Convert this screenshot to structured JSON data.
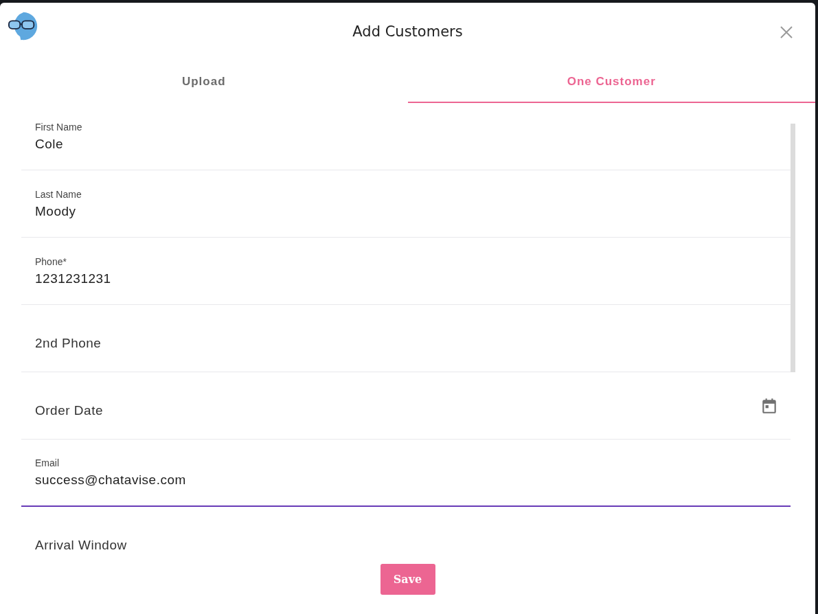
{
  "dialog": {
    "title": "Add Customers"
  },
  "tabs": [
    {
      "label": "Upload",
      "selected": false
    },
    {
      "label": "One Customer",
      "selected": true
    }
  ],
  "fields": [
    {
      "kind": "text",
      "label": "First Name",
      "value": "Cole",
      "focused": false
    },
    {
      "kind": "text",
      "label": "Last Name",
      "value": "Moody",
      "focused": false
    },
    {
      "kind": "text",
      "label": "Phone*",
      "value": "1231231231",
      "focused": false
    },
    {
      "kind": "text",
      "placeholder": "2nd Phone",
      "focused": false
    },
    {
      "kind": "date",
      "placeholder": "Order Date",
      "focused": false
    },
    {
      "kind": "text",
      "label": "Email",
      "value": "success@chatavise.com",
      "focused": true
    },
    {
      "kind": "text",
      "placeholder": "Arrival Window",
      "focused": false
    }
  ],
  "save_button": "Save"
}
